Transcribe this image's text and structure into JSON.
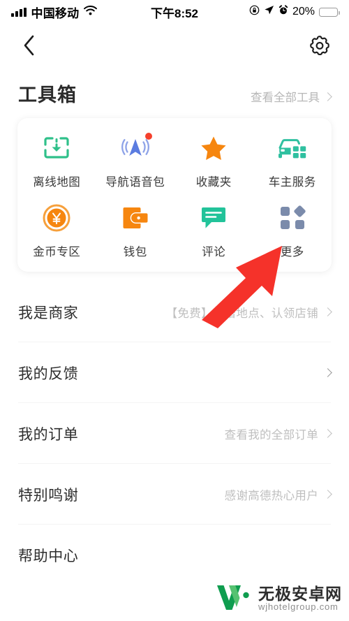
{
  "statusbar": {
    "carrier": "中国移动",
    "signal_icon": "signal-bars-icon",
    "wifi_icon": "wifi-icon",
    "time": "下午8:52",
    "rotation_lock_icon": "rotation-lock-icon",
    "location_icon": "location-arrow-icon",
    "alarm_icon": "alarm-clock-icon",
    "battery_percent": "20%",
    "battery_level": 20,
    "battery_color": "#f5301e"
  },
  "navbar": {
    "back_icon": "back-chevron-icon",
    "settings_icon": "gear-icon"
  },
  "toolbox": {
    "title": "工具箱",
    "view_all_label": "查看全部工具",
    "view_all_chevron": "chevron-right-icon",
    "rows": [
      [
        {
          "label": "离线地图",
          "icon": "offline-map-download-icon",
          "color": "#2fc08a",
          "badge": false
        },
        {
          "label": "导航语音包",
          "icon": "navigation-voice-icon",
          "color": "#5b7ce0",
          "badge": true
        },
        {
          "label": "收藏夹",
          "icon": "star-icon",
          "color": "#f6860f",
          "badge": false
        },
        {
          "label": "车主服务",
          "icon": "car-service-icon",
          "color": "#2fc0a0",
          "badge": false
        }
      ],
      [
        {
          "label": "金币专区",
          "icon": "gold-coin-icon",
          "color": "#f6860f",
          "badge": false
        },
        {
          "label": "钱包",
          "icon": "wallet-icon",
          "color": "#f6860f",
          "badge": false
        },
        {
          "label": "评论",
          "icon": "comment-bubble-icon",
          "color": "#22c39a",
          "badge": false
        },
        {
          "label": "更多",
          "icon": "more-grid-icon",
          "color": "#7b8bab",
          "badge": false
        }
      ]
    ]
  },
  "list": {
    "items": [
      {
        "title": "我是商家",
        "sub": "【免费】新增地点、认领店铺",
        "chevron": "chevron-right-icon"
      },
      {
        "title": "我的反馈",
        "sub": "",
        "chevron": "chevron-right-icon"
      },
      {
        "title": "我的订单",
        "sub": "查看我的全部订单",
        "chevron": "chevron-right-icon"
      },
      {
        "title": "特别鸣谢",
        "sub": "感谢高德热心用户",
        "chevron": "chevron-right-icon"
      },
      {
        "title": "帮助中心",
        "sub": "",
        "chevron": "chevron-right-icon"
      }
    ]
  },
  "annotation": {
    "arrow_icon": "red-pointer-arrow",
    "color": "#f5322a",
    "points_to": "更多"
  },
  "watermark": {
    "logo_icon": "w-logo-icon",
    "logo_color": "#20a84a",
    "name_cn": "无极安卓网",
    "name_en": "wjhotelgroup.com"
  }
}
